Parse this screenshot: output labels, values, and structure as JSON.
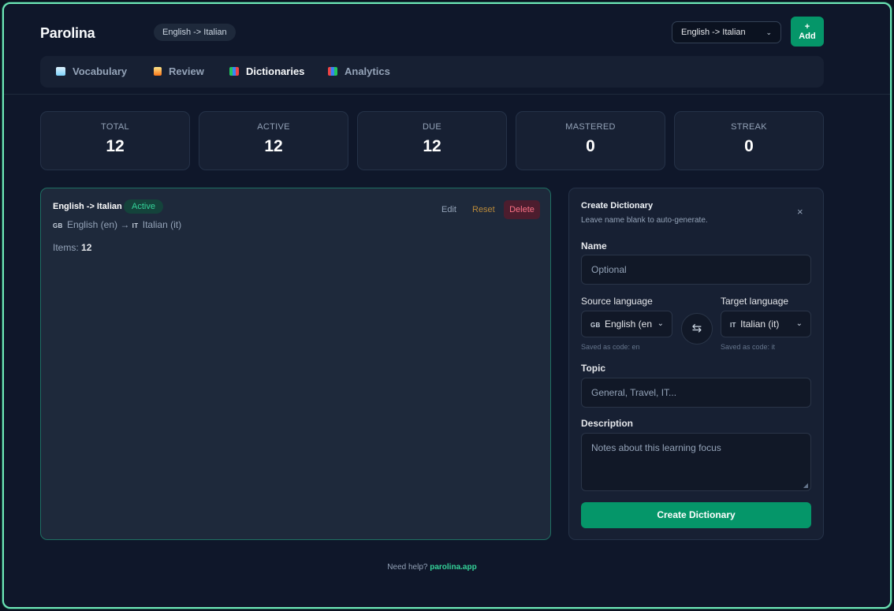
{
  "app": {
    "title": "Parolina"
  },
  "header": {
    "pair_pill": "English -> Italian",
    "pair_select": "English -> Italian",
    "add_label": "Add"
  },
  "nav": {
    "items": [
      {
        "label": "Vocabulary",
        "icon": "book-icon"
      },
      {
        "label": "Review",
        "icon": "page-icon"
      },
      {
        "label": "Dictionaries",
        "icon": "books-icon",
        "active": true
      },
      {
        "label": "Analytics",
        "icon": "chart-icon"
      }
    ]
  },
  "stats": [
    {
      "label": "TOTAL",
      "value": "12"
    },
    {
      "label": "ACTIVE",
      "value": "12"
    },
    {
      "label": "DUE",
      "value": "12"
    },
    {
      "label": "MASTERED",
      "value": "0"
    },
    {
      "label": "STREAK",
      "value": "0"
    }
  ],
  "dictionary": {
    "title": "English -> Italian",
    "status": "Active",
    "source_flag": "GB",
    "source": "English (en)",
    "arrow": "→",
    "target_flag": "IT",
    "target": "Italian (it)",
    "items_label": "Items:",
    "items_count": "12",
    "actions": {
      "edit": "Edit",
      "reset": "Reset",
      "delete": "Delete"
    }
  },
  "create_panel": {
    "title": "Create Dictionary",
    "subtitle": "Leave name blank to auto-generate.",
    "close": "×",
    "name_label": "Name",
    "name_placeholder": "Optional",
    "source_label": "Source language",
    "source_flag": "GB",
    "source_value": "English (en",
    "source_hint": "Saved as code: en",
    "target_label": "Target language",
    "target_flag": "IT",
    "target_value": "Italian (it)",
    "target_hint": "Saved as code: it",
    "swap_icon": "⇆",
    "topic_label": "Topic",
    "topic_placeholder": "General, Travel, IT...",
    "description_label": "Description",
    "description_placeholder": "Notes about this learning focus",
    "submit_label": "Create Dictionary"
  },
  "footer": {
    "text": "Need help?",
    "link": "parolina.app"
  },
  "colors": {
    "accent": "#059669",
    "active_badge": "#34d399",
    "delete": "#fb7185",
    "reset": "#b9893a"
  }
}
